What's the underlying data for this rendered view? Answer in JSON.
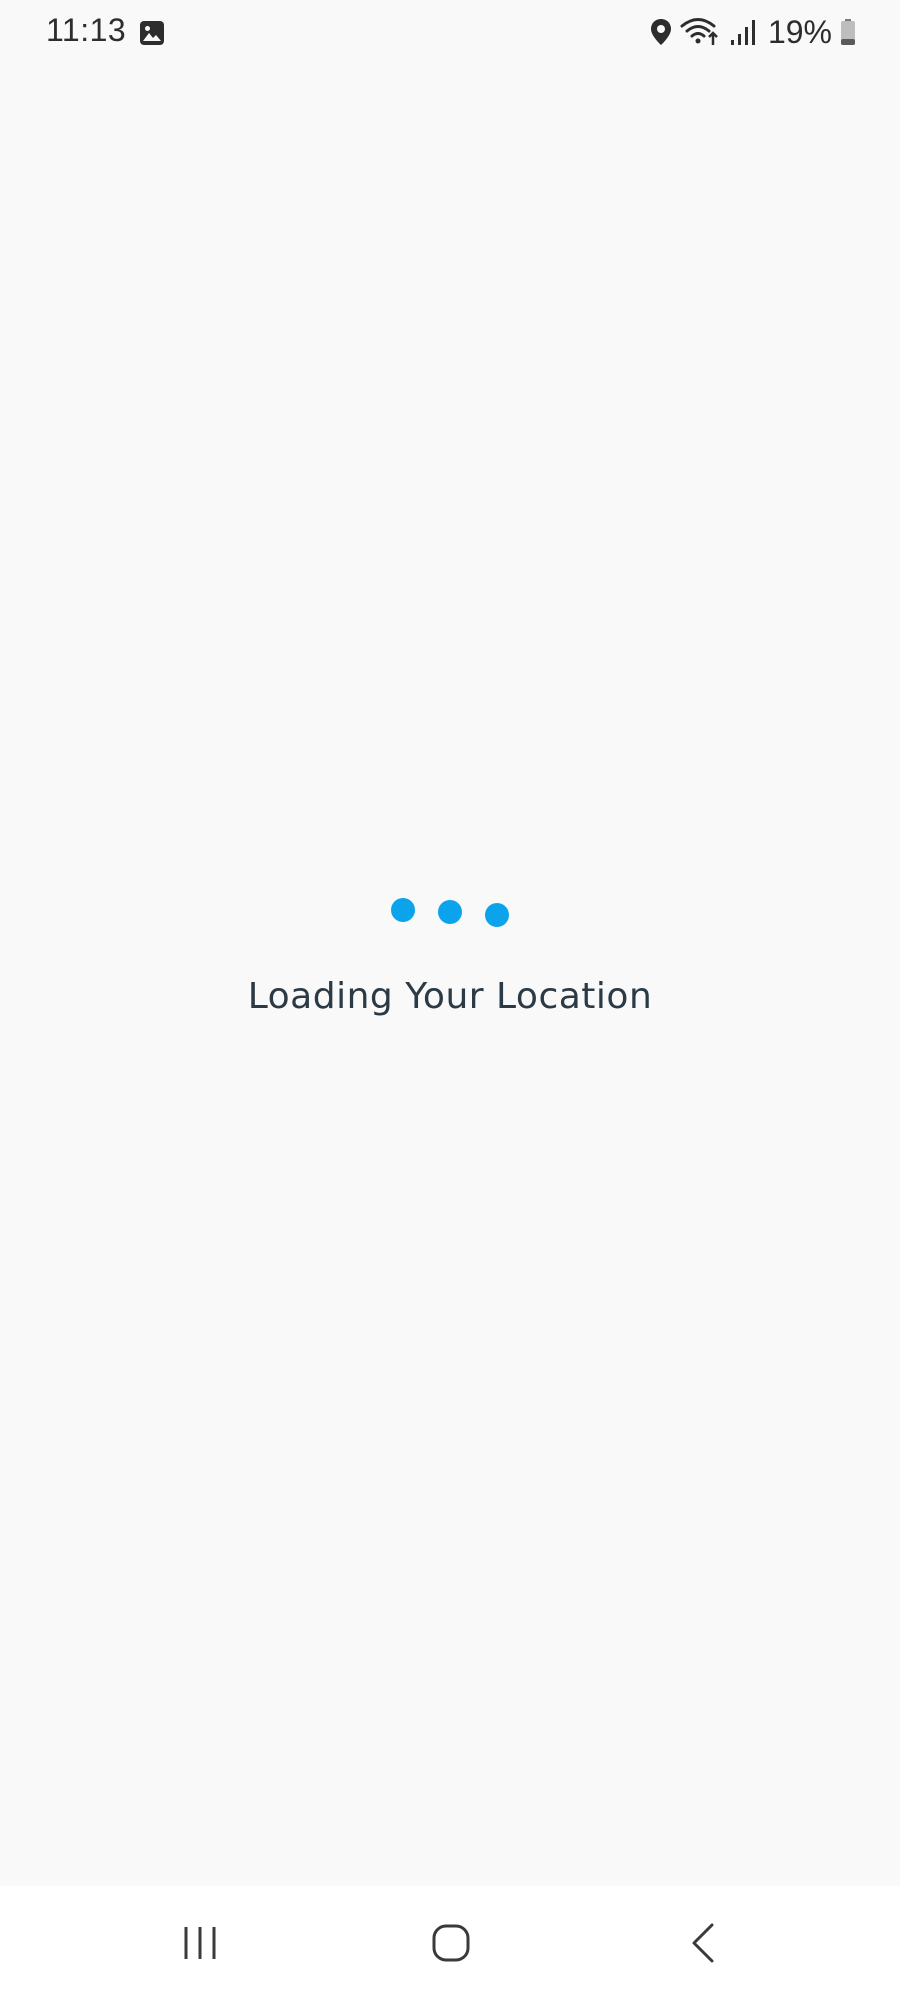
{
  "status_bar": {
    "time": "11:13",
    "battery_percent": "19%",
    "icons": [
      "gallery-icon",
      "location-icon",
      "wifi-icon",
      "signal-icon",
      "battery-icon"
    ]
  },
  "loader": {
    "dot_color": "#0ba3ec",
    "dots": 3
  },
  "message": {
    "text": "Loading Your Location"
  },
  "nav_bar": {
    "buttons": [
      "recents",
      "home",
      "back"
    ]
  }
}
